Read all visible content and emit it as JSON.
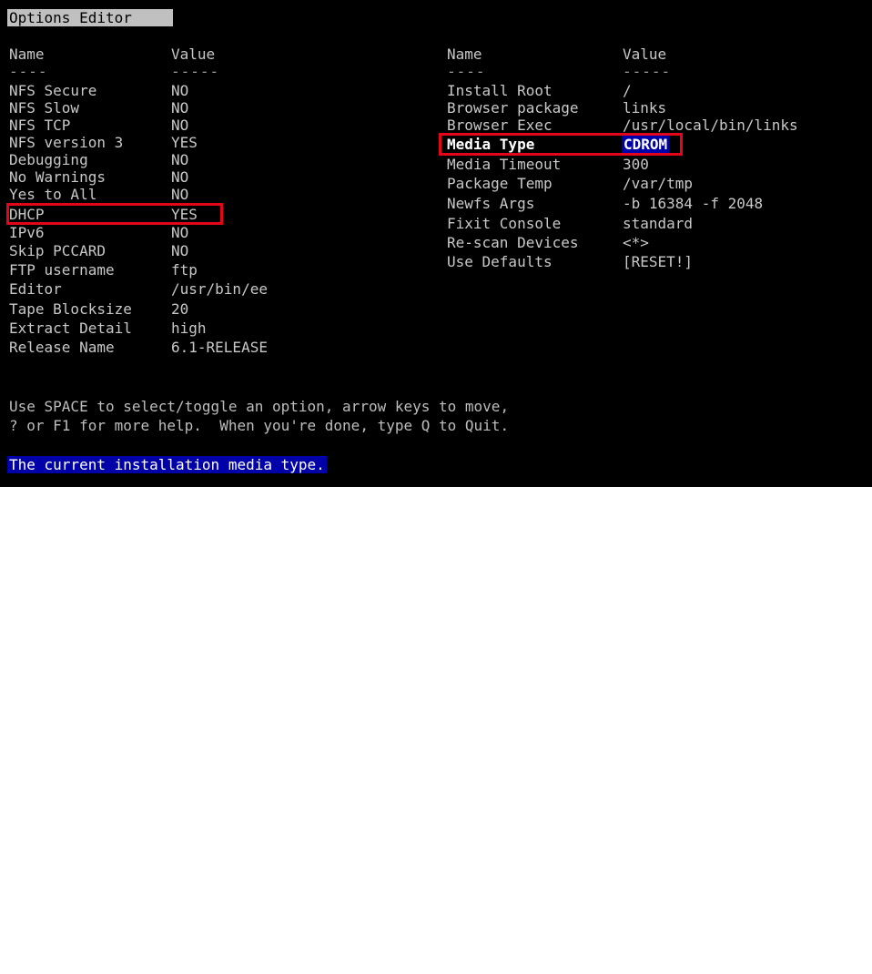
{
  "title": "Options Editor",
  "columns": {
    "name": "Name",
    "value": "Value",
    "name_sep": "----",
    "value_sep": "-----"
  },
  "left_options": [
    {
      "name": "NFS Secure",
      "value": "NO"
    },
    {
      "name": "NFS Slow",
      "value": "NO"
    },
    {
      "name": "NFS TCP",
      "value": "NO"
    },
    {
      "name": "NFS version 3",
      "value": "YES"
    },
    {
      "name": "Debugging",
      "value": "NO"
    },
    {
      "name": "No Warnings",
      "value": "NO"
    },
    {
      "name": "Yes to All",
      "value": "NO"
    },
    {
      "name": "DHCP",
      "value": "YES"
    },
    {
      "name": "IPv6",
      "value": "NO"
    },
    {
      "name": "Skip PCCARD",
      "value": "NO"
    },
    {
      "name": "FTP username",
      "value": "ftp"
    },
    {
      "name": "Editor",
      "value": "/usr/bin/ee"
    },
    {
      "name": "Tape Blocksize",
      "value": "20"
    },
    {
      "name": "Extract Detail",
      "value": "high"
    },
    {
      "name": "Release Name",
      "value": "6.1-RELEASE"
    }
  ],
  "right_options": [
    {
      "name": "Install Root",
      "value": "/"
    },
    {
      "name": "Browser package",
      "value": "links"
    },
    {
      "name": "Browser Exec",
      "value": "/usr/local/bin/links"
    },
    {
      "name": "Media Type",
      "value": "CDROM"
    },
    {
      "name": "Media Timeout",
      "value": "300"
    },
    {
      "name": "Package Temp",
      "value": "/var/tmp"
    },
    {
      "name": "Newfs Args",
      "value": "-b 16384 -f 2048"
    },
    {
      "name": "Fixit Console",
      "value": "standard"
    },
    {
      "name": "Re-scan Devices",
      "value": "<*>"
    },
    {
      "name": "Use Defaults",
      "value": "[RESET!]"
    }
  ],
  "help_lines": [
    "Use SPACE to select/toggle an option, arrow keys to move,",
    "? or F1 for more help.  When you're done, type Q to Quit."
  ],
  "status": "The current installation media type.",
  "colors": {
    "screen": "#000000",
    "text": "#c8c8c8",
    "title_bg": "#c0c0c0",
    "selection_bg": "#0000a8",
    "highlight_box": "#e3061b"
  }
}
